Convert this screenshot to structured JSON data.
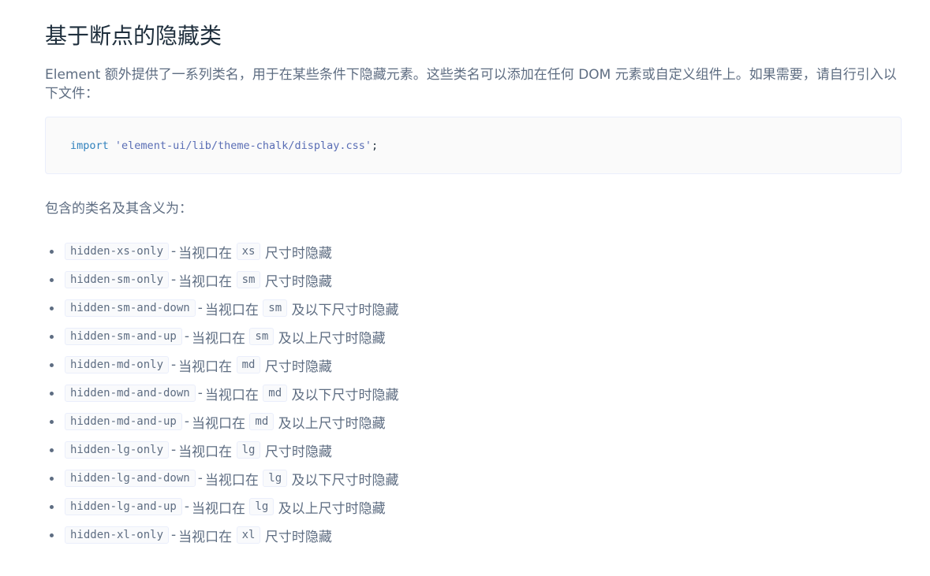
{
  "page": {
    "title": "基于断点的隐藏类",
    "intro": "Element 额外提供了一系列类名，用于在某些条件下隐藏元素。这些类名可以添加在任何 DOM 元素或自定义组件上。如果需要，请自行引入以下文件：",
    "code": {
      "keyword": "import",
      "string": "'element-ui/lib/theme-chalk/display.css'",
      "terminator": ";"
    },
    "list_heading": "包含的类名及其含义为："
  },
  "classes": [
    {
      "name": "hidden-xs-only",
      "dash": "-",
      "pre": "当视口在",
      "size": "xs",
      "post": "尺寸时隐藏"
    },
    {
      "name": "hidden-sm-only",
      "dash": "-",
      "pre": "当视口在",
      "size": "sm",
      "post": "尺寸时隐藏"
    },
    {
      "name": "hidden-sm-and-down",
      "dash": "-",
      "pre": "当视口在",
      "size": "sm",
      "post": "及以下尺寸时隐藏"
    },
    {
      "name": "hidden-sm-and-up",
      "dash": "-",
      "pre": "当视口在",
      "size": "sm",
      "post": "及以上尺寸时隐藏"
    },
    {
      "name": "hidden-md-only",
      "dash": "-",
      "pre": "当视口在",
      "size": "md",
      "post": "尺寸时隐藏"
    },
    {
      "name": "hidden-md-and-down",
      "dash": "-",
      "pre": "当视口在",
      "size": "md",
      "post": "及以下尺寸时隐藏"
    },
    {
      "name": "hidden-md-and-up",
      "dash": "-",
      "pre": "当视口在",
      "size": "md",
      "post": "及以上尺寸时隐藏"
    },
    {
      "name": "hidden-lg-only",
      "dash": "-",
      "pre": "当视口在",
      "size": "lg",
      "post": "尺寸时隐藏"
    },
    {
      "name": "hidden-lg-and-down",
      "dash": "-",
      "pre": "当视口在",
      "size": "lg",
      "post": "及以下尺寸时隐藏"
    },
    {
      "name": "hidden-lg-and-up",
      "dash": "-",
      "pre": "当视口在",
      "size": "lg",
      "post": "及以上尺寸时隐藏"
    },
    {
      "name": "hidden-xl-only",
      "dash": "-",
      "pre": "当视口在",
      "size": "xl",
      "post": "尺寸时隐藏"
    }
  ]
}
